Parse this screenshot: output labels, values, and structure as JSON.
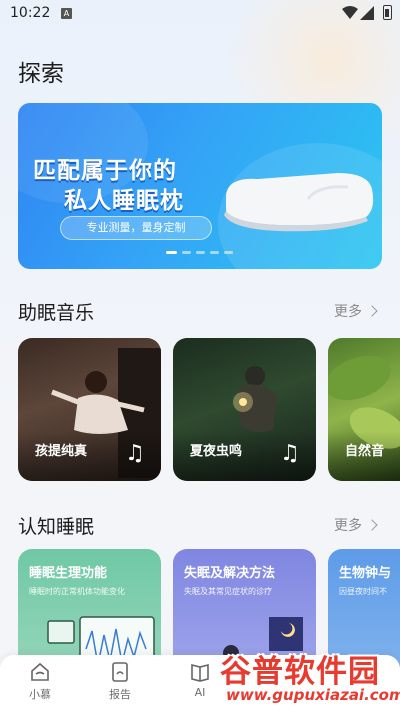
{
  "status_bar": {
    "time": "10:22",
    "notif_badge": "A"
  },
  "page": {
    "title": "探索"
  },
  "banner": {
    "line1": "匹配属于你的",
    "line2": "私人睡眠枕",
    "pill": "专业测量，量身定制",
    "dots_total": 5,
    "active_dot": 1
  },
  "music": {
    "title": "助眠音乐",
    "more": "更多",
    "cards": [
      {
        "label": "孩提纯真"
      },
      {
        "label": "夏夜虫鸣"
      },
      {
        "label": "自然音"
      }
    ]
  },
  "cognition": {
    "title": "认知睡眠",
    "more": "更多",
    "cards": [
      {
        "title": "睡眠生理功能",
        "subtitle": "睡眠时的正常机体功能变化"
      },
      {
        "title": "失眠及解决方法",
        "subtitle": "失眠及其常见症状的诊疗"
      },
      {
        "title": "生物钟与",
        "subtitle": "因昼夜时间不"
      }
    ]
  },
  "tabbar": {
    "items": [
      {
        "label": "小慕"
      },
      {
        "label": "报告"
      },
      {
        "label": "AI"
      }
    ]
  },
  "watermark": {
    "name": "谷普软件园",
    "url": "www.gupuxiazai.com"
  }
}
